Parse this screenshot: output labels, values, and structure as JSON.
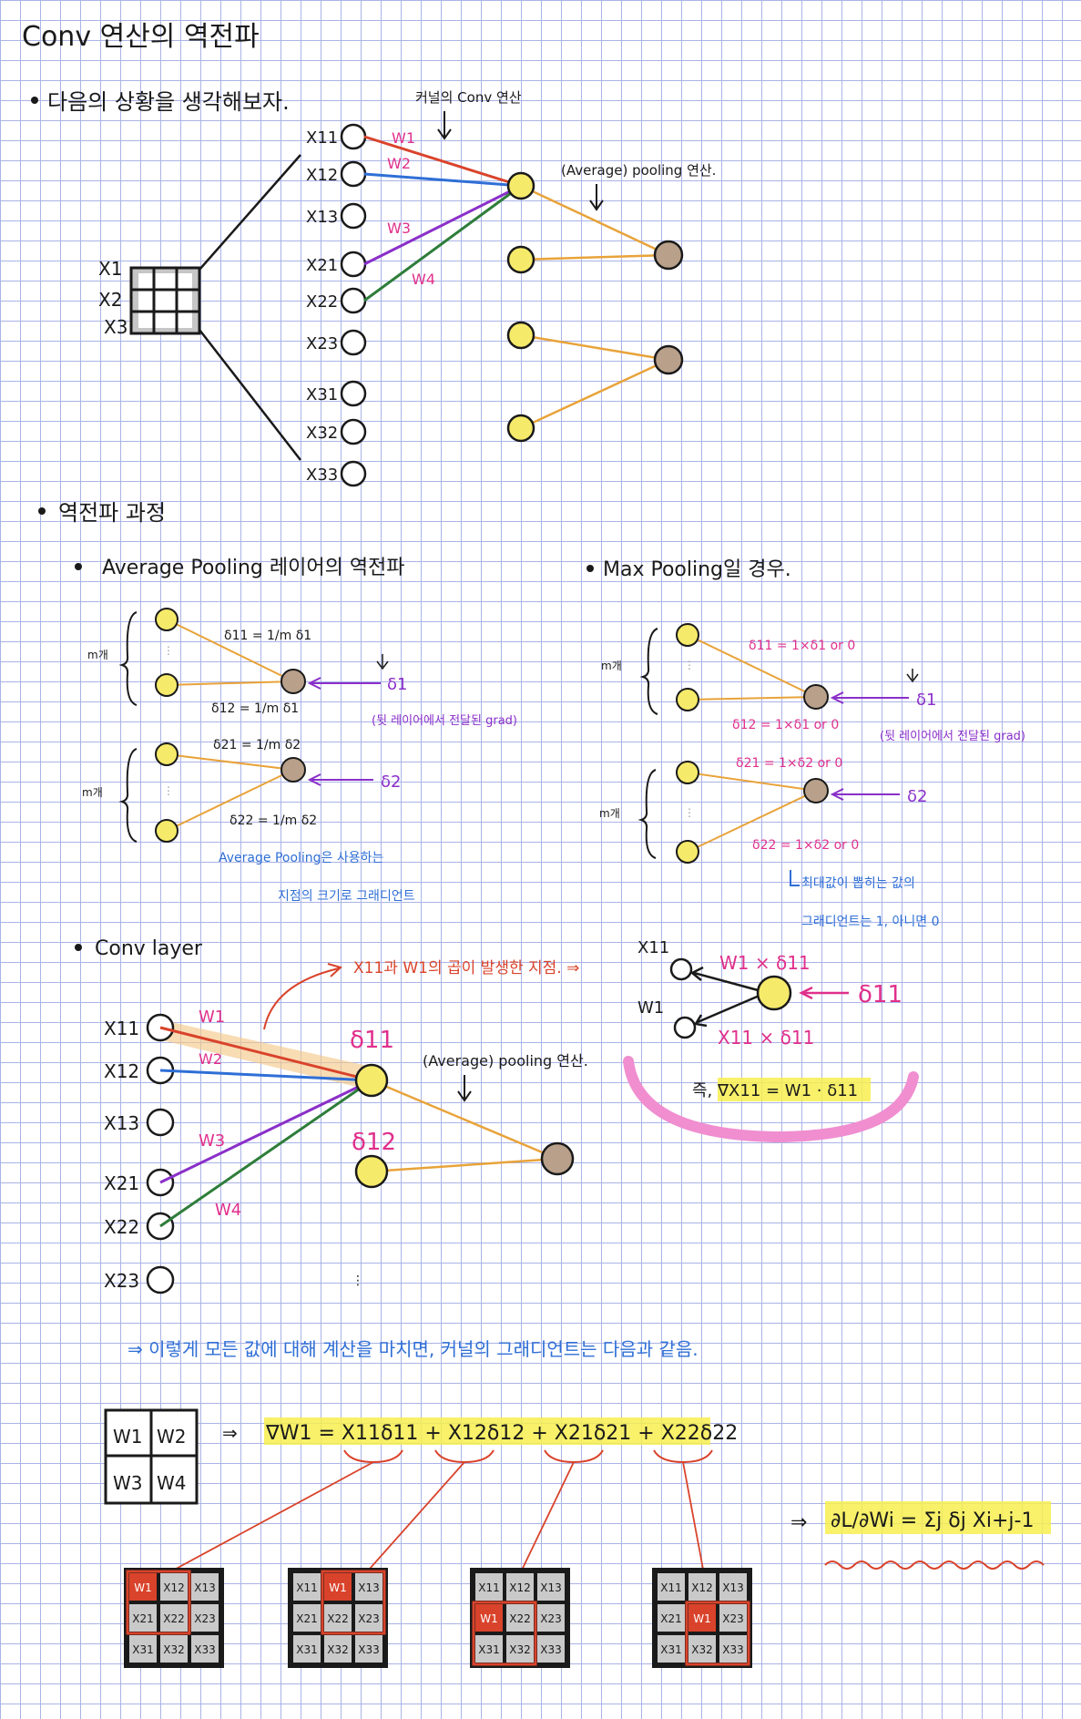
{
  "title": "Conv 연산의 역전파",
  "section1": {
    "bullet": "다음의 상황을 생각해보자.",
    "kernel_note": "커널의 Conv 연산",
    "pool_note": "(Average) pooling 연산.",
    "input_rows": [
      "X1",
      "X2",
      "X3"
    ],
    "input_nodes": [
      "X11",
      "X12",
      "X13",
      "X21",
      "X22",
      "X23",
      "X31",
      "X32",
      "X33"
    ],
    "weights": [
      "W1",
      "W2",
      "W3",
      "W4"
    ]
  },
  "section2": {
    "bullet": "역전파 과정",
    "avg": {
      "bullet": "Average Pooling 레이어의 역전파",
      "m_label": "m개",
      "d11": "δ11 = 1/m δ1",
      "d12": "δ12 = 1/m δ1",
      "d21": "δ21 = 1/m δ2",
      "d22": "δ22 = 1/m δ2",
      "grad1": "δ1",
      "grad2": "δ2",
      "grad_note": "(뒷 레이어에서 전달된 grad)",
      "note1": "Average Pooling은 사용하는",
      "note2": "지점의 크기로 그래디언트"
    },
    "max": {
      "bullet": "Max Pooling일 경우.",
      "m_label": "m개",
      "d11": "δ11 = 1×δ1 or 0",
      "d12": "δ12 = 1×δ1 or 0",
      "d21": "δ21 = 1×δ2 or 0",
      "d22": "δ22 = 1×δ2 or 0",
      "grad1": "δ1",
      "grad2": "δ2",
      "grad_note": "(뒷 레이어에서 전달된 grad)",
      "note1": "최대값이 뽑히는 값의",
      "note2": "그래디언트는 1, 아니면 0"
    },
    "conv": {
      "bullet": "Conv layer",
      "annotation": "X11과 W1의 곱이 발생한 지점. ⇒",
      "pool_note": "(Average) pooling 연산.",
      "nodes": [
        "X11",
        "X12",
        "X13",
        "X21",
        "X22",
        "X23"
      ],
      "weights": [
        "W1",
        "W2",
        "W3",
        "W4"
      ],
      "delta11": "δ11",
      "delta12": "δ12",
      "mini_x": "X11",
      "mini_w": "W1",
      "mini_top": "W1 × δ11",
      "mini_bottom": "X11 × δ11",
      "mini_delta": "δ11",
      "result": "즉, ∇X11 = W1 · δ11"
    }
  },
  "section3": {
    "summary": "⇒ 이렇게 모든 값에 대해 계산을 마치면, 커널의 그래디언트는 다음과 같음.",
    "kernel": [
      "W1",
      "W2",
      "W3",
      "W4"
    ],
    "formula": "∇W1 = X11δ11 + X12δ12 + X21δ21 + X22δ22",
    "final_formula": "∂L/∂Wi = Σj δj Xi+j-1",
    "grids": [
      [
        "W1",
        "X12",
        "X13",
        "X21",
        "X22",
        "X23",
        "X31",
        "X32",
        "X33"
      ],
      [
        "X11",
        "W1",
        "X13",
        "X21",
        "X22",
        "X23",
        "X31",
        "X32",
        "X33"
      ],
      [
        "X11",
        "X12",
        "X13",
        "W1",
        "X22",
        "X23",
        "X31",
        "X32",
        "X33"
      ],
      [
        "X11",
        "X12",
        "X13",
        "X21",
        "W1",
        "X23",
        "X31",
        "X32",
        "X33"
      ]
    ],
    "highlight": [
      0,
      1,
      3,
      4
    ]
  },
  "colors": {
    "red": "#d9432b",
    "blue": "#2f6fd6",
    "purple": "#8a2fc9",
    "green": "#2e7d3a",
    "orange": "#e8a33a",
    "yellow_node": "#f6ea6a",
    "brown_node": "#b9a08a",
    "magenta": "#e0308c",
    "ink": "#1a1a1a",
    "highlight": "#f7ef4f"
  }
}
